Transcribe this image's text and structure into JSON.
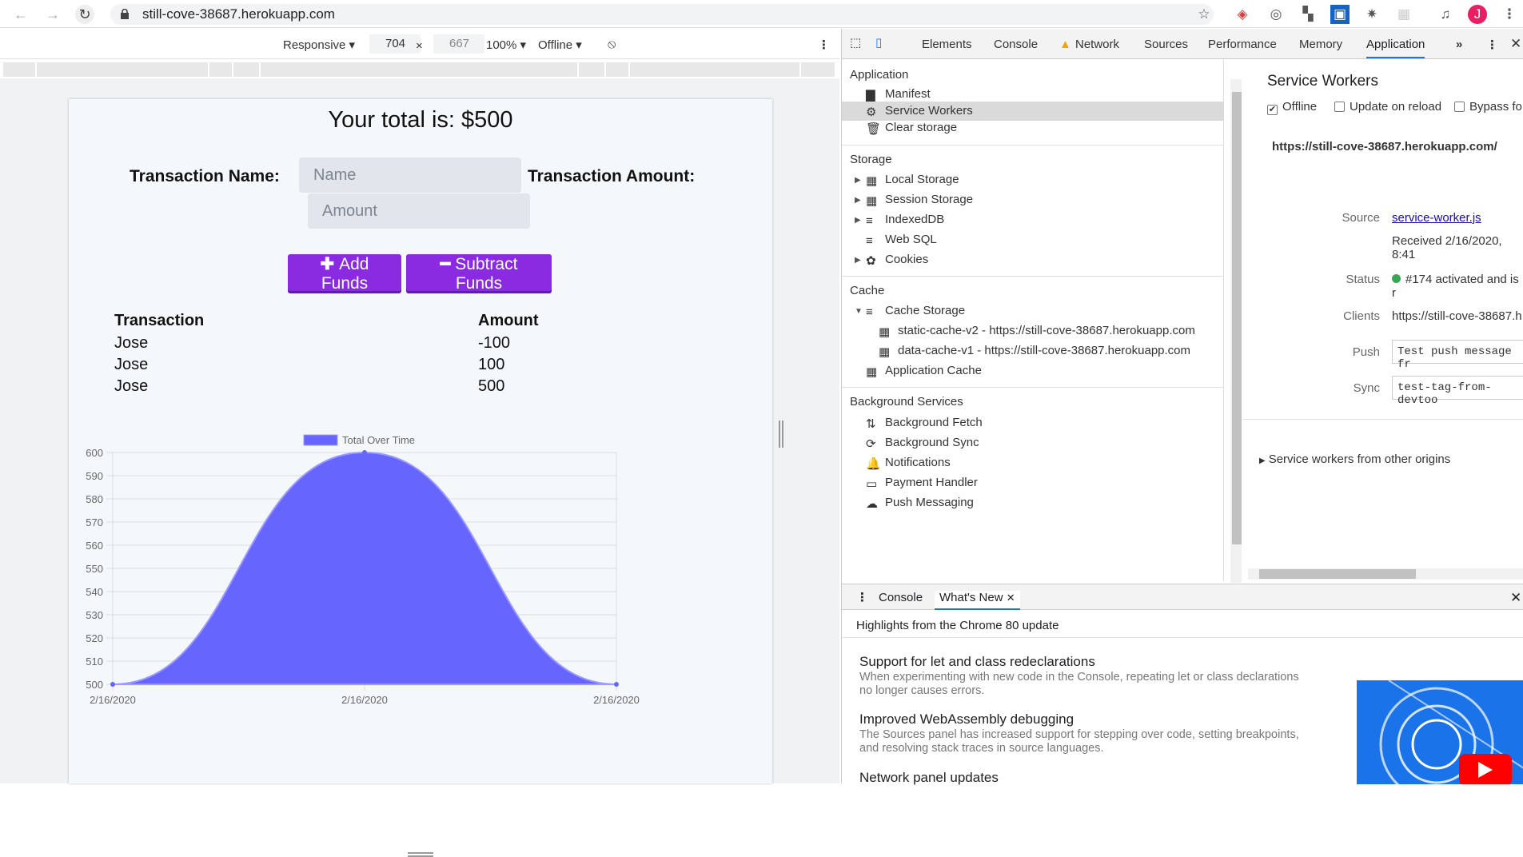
{
  "browser": {
    "url": "still-cove-38687.herokuapp.com",
    "avatar_letter": "J"
  },
  "device_toolbar": {
    "mode": "Responsive",
    "width": "704",
    "times": "×",
    "height": "667",
    "zoom": "100%",
    "network": "Offline"
  },
  "app": {
    "total": "Your total is: $500",
    "name_label": "Transaction Name:",
    "name_placeholder": "Name",
    "amount_label": "Transaction Amount:",
    "amount_placeholder": "Amount",
    "add_button": "Add Funds",
    "subtract_button": "Subtract Funds",
    "table": {
      "headers": [
        "Transaction",
        "Amount"
      ],
      "rows": [
        {
          "name": "Jose",
          "amount": "-100"
        },
        {
          "name": "Jose",
          "amount": "100"
        },
        {
          "name": "Jose",
          "amount": "500"
        }
      ]
    }
  },
  "chart_data": {
    "type": "area",
    "series": [
      {
        "name": "Total Over Time",
        "color": "#6666ff",
        "values": [
          500,
          600,
          500
        ]
      }
    ],
    "x": [
      "2/16/2020",
      "2/16/2020",
      "2/16/2020"
    ],
    "y_ticks": [
      500,
      510,
      520,
      530,
      540,
      550,
      560,
      570,
      580,
      590,
      600
    ],
    "ylim": [
      500,
      600
    ],
    "legend": "top",
    "grid": true
  },
  "devtools": {
    "tabs": [
      "Elements",
      "Console",
      "Network",
      "Sources",
      "Performance",
      "Memory",
      "Application"
    ],
    "active_tab": "Application",
    "sidebar": {
      "application_header": "Application",
      "application_items": [
        "Manifest",
        "Service Workers",
        "Clear storage"
      ],
      "storage_header": "Storage",
      "storage_items": [
        "Local Storage",
        "Session Storage",
        "IndexedDB",
        "Web SQL",
        "Cookies"
      ],
      "cache_header": "Cache",
      "cache_items": [
        "Cache Storage",
        "static-cache-v2 - https://still-cove-38687.herokuapp.com",
        "data-cache-v1 - https://still-cove-38687.herokuapp.com",
        "Application Cache"
      ],
      "background_header": "Background Services",
      "background_items": [
        "Background Fetch",
        "Background Sync",
        "Notifications",
        "Payment Handler",
        "Push Messaging"
      ]
    },
    "service_workers": {
      "title": "Service Workers",
      "offline": "Offline",
      "update_on_reload": "Update on reload",
      "bypass": "Bypass fo",
      "origin": "https://still-cove-38687.herokuapp.com/",
      "source_label": "Source",
      "source_link": "service-worker.js",
      "received": "Received 2/16/2020, 8:41",
      "status_label": "Status",
      "status_text": "#174 activated and is r",
      "clients_label": "Clients",
      "clients_value": "https://still-cove-38687.h",
      "push_label": "Push",
      "push_value": "Test push message fr",
      "sync_label": "Sync",
      "sync_value": "test-tag-from-devtoo",
      "other_origins": "Service workers from other origins"
    },
    "drawer": {
      "tabs": [
        "Console",
        "What's New"
      ],
      "highlights": "Highlights from the Chrome 80 update",
      "items": [
        {
          "title": "Support for let and class redeclarations",
          "desc": "When experimenting with new code in the Console, repeating let or class declarations no longer causes errors."
        },
        {
          "title": "Improved WebAssembly debugging",
          "desc": "The Sources panel has increased support for stepping over code, setting breakpoints, and resolving stack traces in source languages."
        },
        {
          "title": "Network panel updates",
          "desc": ""
        }
      ]
    }
  }
}
